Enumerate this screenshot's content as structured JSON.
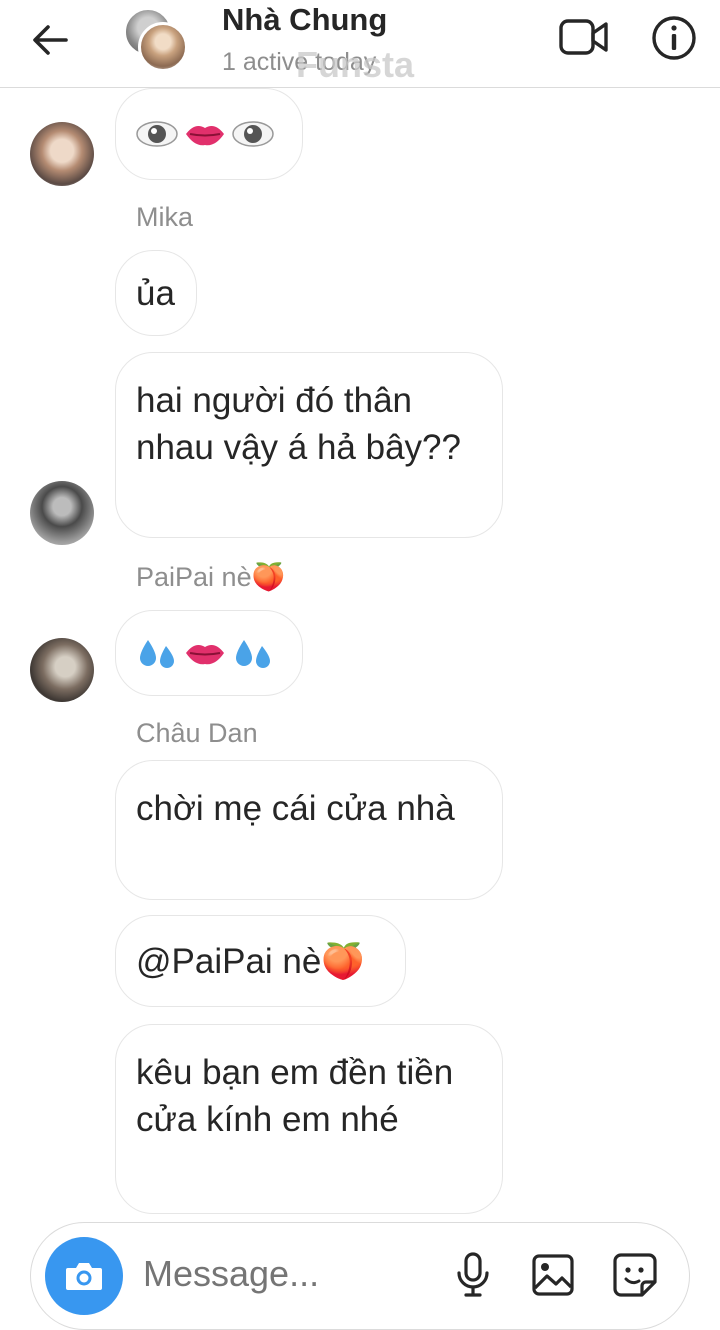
{
  "header": {
    "back_icon": "arrow-left-icon",
    "title": "Nhà Chung",
    "status": "1 active today",
    "watermark": "Funsta",
    "video_icon": "video-call-icon",
    "info_icon": "info-icon"
  },
  "messages": [
    {
      "sender": "",
      "text": "👁👄👁",
      "emoji_only": true,
      "avatar": "member-avatar-1"
    },
    {
      "sender": "Mika",
      "text": "ủa"
    },
    {
      "sender": "",
      "text": "hai người đó thân nhau vậy á hả bây??",
      "avatar": "member-avatar-2"
    },
    {
      "sender": "PaiPai nè🍑",
      "text": "💦👄💦",
      "emoji_only": true,
      "avatar": "member-avatar-3"
    },
    {
      "sender": "Châu Dan",
      "text": "chời mẹ cái cửa nhà"
    },
    {
      "sender": "",
      "text": "@PaiPai nè🍑"
    },
    {
      "sender": "",
      "text": "kêu bạn em đền tiền cửa kính em nhé"
    }
  ],
  "composer": {
    "camera_icon": "camera-icon",
    "placeholder": "Message...",
    "mic_icon": "microphone-icon",
    "image_icon": "image-icon",
    "sticker_icon": "sticker-icon"
  },
  "colors": {
    "accent": "#3897f0",
    "bubble_border": "#e6e6e6",
    "secondary_text": "#8e8e8e"
  }
}
